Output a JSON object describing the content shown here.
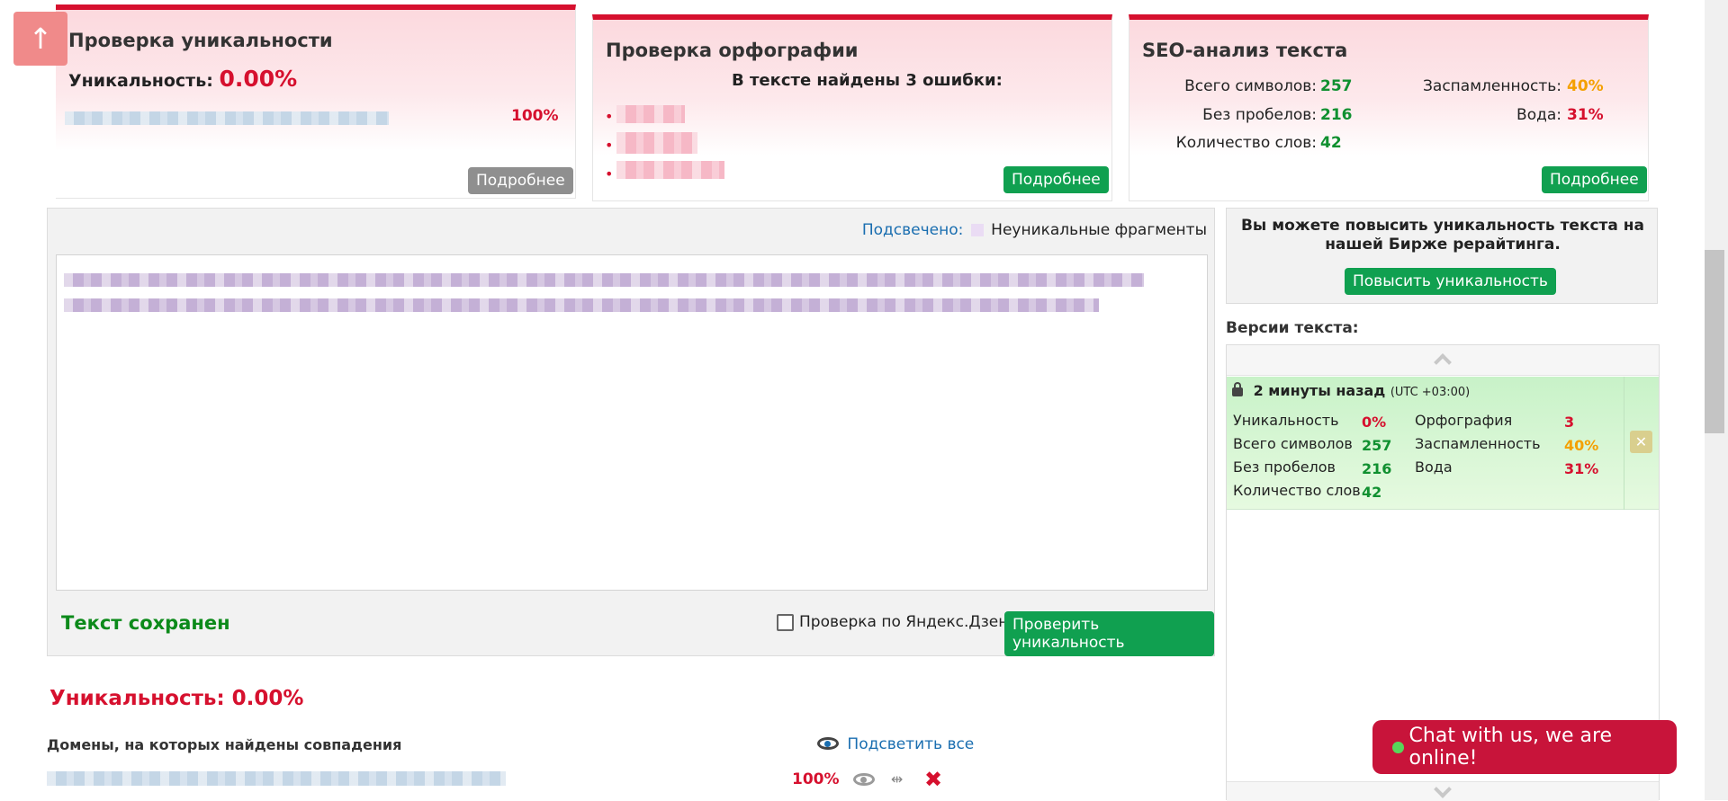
{
  "uniqueness_card": {
    "title": "Проверка уникальности",
    "label": "Уникальность:",
    "value": "0.00%",
    "match_percent": "100%",
    "button": "Подробнее"
  },
  "spelling_card": {
    "title": "Проверка орфографии",
    "summary": "В тексте найдены 3 ошибки:",
    "button": "Подробнее"
  },
  "seo_card": {
    "title": "SEO-анализ текста",
    "total_chars_label": "Всего символов:",
    "total_chars": "257",
    "no_spaces_label": "Без пробелов:",
    "no_spaces": "216",
    "words_label": "Количество слов:",
    "words": "42",
    "spam_label": "Заспамленность:",
    "spam": "40%",
    "water_label": "Вода:",
    "water": "31%",
    "button": "Подробнее"
  },
  "editor": {
    "highlight_label": "Подсвечено:",
    "legend_label": "Неуникальные фрагменты",
    "saved_status": "Текст сохранен",
    "yandex_checkbox_label": "Проверка по Яндекс.Дзен",
    "check_button": "Проверить уникальность"
  },
  "promo": {
    "text": "Вы можете повысить уникальность текста на нашей Бирже рерайтинга.",
    "button": "Повысить уникальность"
  },
  "versions": {
    "title": "Версии текста:",
    "item": {
      "time": "2 минуты назад",
      "tz": "(UTC +03:00)",
      "uniq_label": "Уникальность",
      "uniq": "0%",
      "spell_label": "Орфография",
      "spell": "3",
      "chars_label": "Всего символов",
      "chars": "257",
      "spam_label": "Заспамленность",
      "spam": "40%",
      "nospace_label": "Без пробелов",
      "nospace": "216",
      "water_label": "Вода",
      "water": "31%",
      "words_label": "Количество слов",
      "words": "42"
    }
  },
  "results": {
    "title": "Уникальность: 0.00%",
    "domains_label": "Домены, на которых найдены совпадения",
    "highlight_all": "Подсветить все",
    "row_percent": "100%"
  },
  "chat": {
    "label": "Chat with us, we are online!"
  },
  "colors": {
    "accent_red": "#d6102e",
    "green": "#10a050",
    "orange": "#f4a000"
  }
}
